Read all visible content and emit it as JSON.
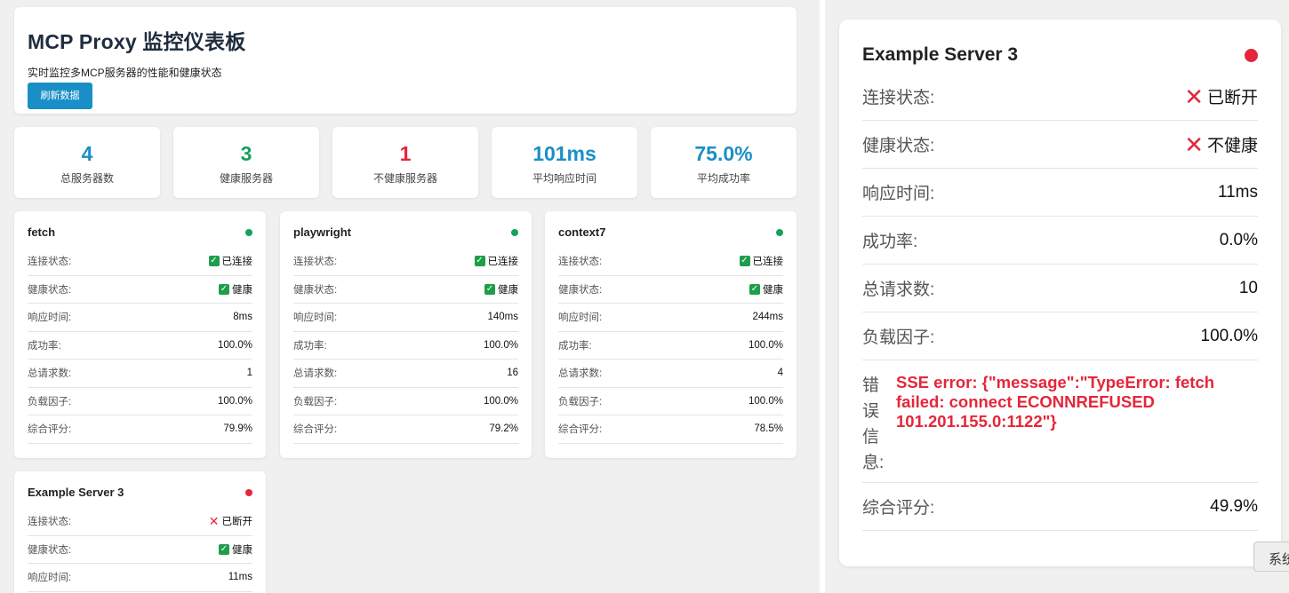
{
  "header": {
    "title": "MCP Proxy 监控仪表板",
    "subtitle": "实时监控多MCP服务器的性能和健康状态",
    "refresh_label": "刷新数据"
  },
  "stats": [
    {
      "value": "4",
      "label": "总服务器数",
      "color": "#1a8fc7"
    },
    {
      "value": "3",
      "label": "健康服务器",
      "color": "#17a05d"
    },
    {
      "value": "1",
      "label": "不健康服务器",
      "color": "#e5263a"
    },
    {
      "value": "101ms",
      "label": "平均响应时间",
      "color": "#1a8fc7"
    },
    {
      "value": "75.0%",
      "label": "平均成功率",
      "color": "#1a8fc7"
    }
  ],
  "labels": {
    "connection": "连接状态:",
    "health": "健康状态:",
    "response": "响应时间:",
    "success": "成功率:",
    "requests": "总请求数:",
    "load": "负载因子:",
    "score": "综合评分:",
    "error": "错误信息:"
  },
  "servers": [
    {
      "name": "fetch",
      "status": "ok",
      "connection": "已连接",
      "health": "健康",
      "response": "8ms",
      "success": "100.0%",
      "requests": "1",
      "load": "100.0%",
      "score": "79.9%"
    },
    {
      "name": "playwright",
      "status": "ok",
      "connection": "已连接",
      "health": "健康",
      "response": "140ms",
      "success": "100.0%",
      "requests": "16",
      "load": "100.0%",
      "score": "79.2%"
    },
    {
      "name": "context7",
      "status": "ok",
      "connection": "已连接",
      "health": "健康",
      "response": "244ms",
      "success": "100.0%",
      "requests": "4",
      "load": "100.0%",
      "score": "78.5%"
    },
    {
      "name": "Example Server 3",
      "status": "bad",
      "connection": "已断开",
      "health": "健康",
      "response": "11ms"
    }
  ],
  "detail": {
    "name": "Example Server 3",
    "connection": "已断开",
    "health": "不健康",
    "response": "11ms",
    "success": "0.0%",
    "requests": "10",
    "load": "100.0%",
    "error": "SSE error: {\"message\":\"TypeError: fetch failed: connect ECONNREFUSED 101.201.155.0:1122\"}",
    "score": "49.9%"
  },
  "sys_tab_label": "系统",
  "icons": {
    "ok": "check-icon",
    "bad": "x-icon",
    "status_ok_color": "#17a05d",
    "status_bad_color": "#e5263a"
  }
}
